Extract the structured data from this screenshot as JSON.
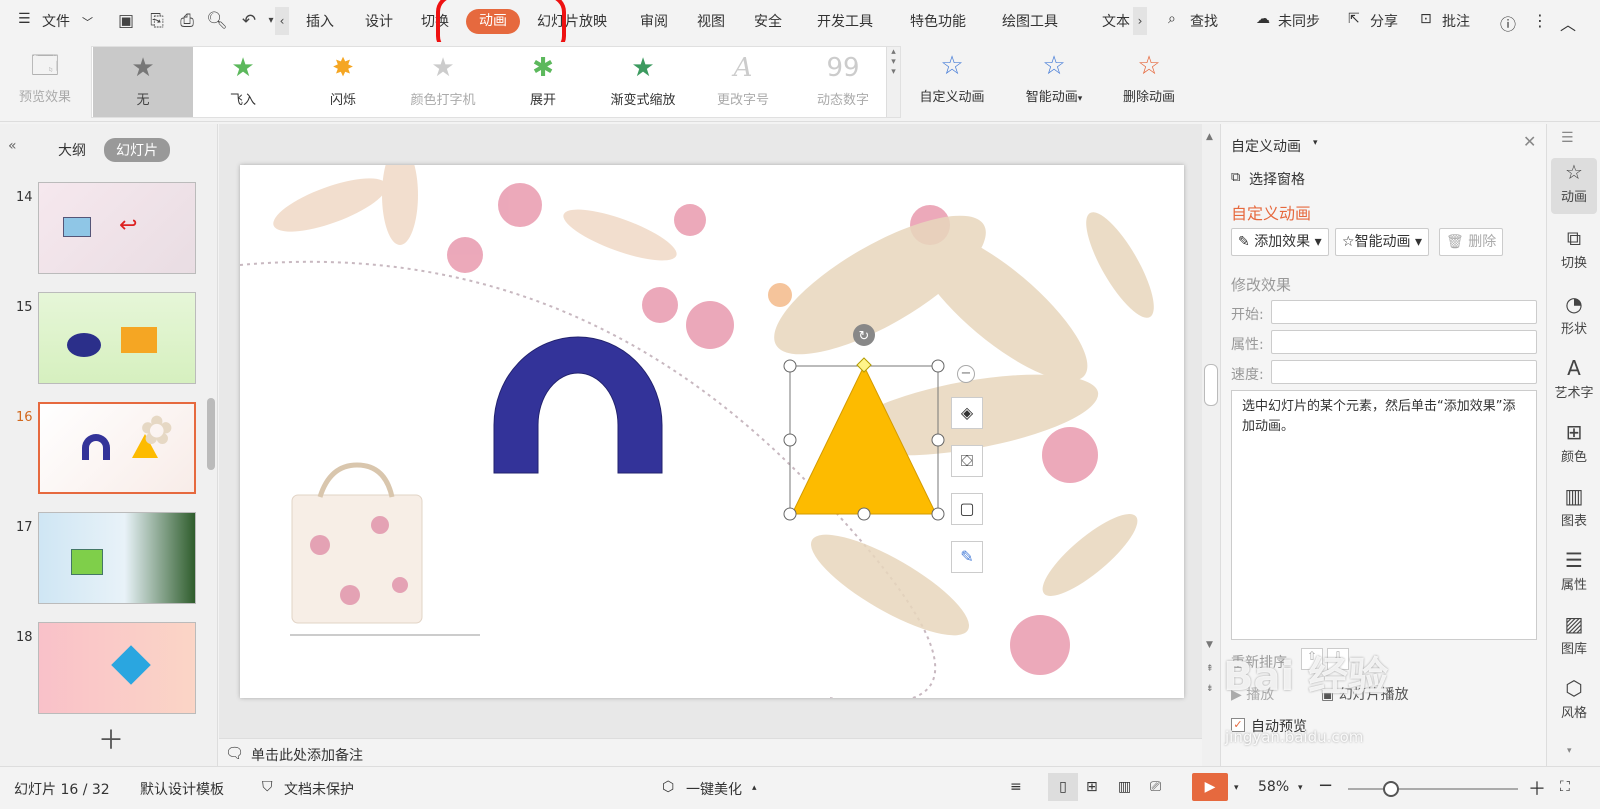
{
  "menubar": {
    "file": "文件",
    "tabs": [
      "插入",
      "设计",
      "切换",
      "动画",
      "幻灯片放映",
      "审阅",
      "视图",
      "安全",
      "开发工具",
      "特色功能",
      "绘图工具",
      "文本"
    ],
    "active_tab": "动画",
    "search": "查找",
    "sync": "未同步",
    "share": "分享",
    "review": "批注"
  },
  "ribbon": {
    "preview": "预览效果",
    "gallery": [
      "无",
      "飞入",
      "闪烁",
      "颜色打字机",
      "展开",
      "渐变式缩放",
      "更改字号",
      "动态数字"
    ],
    "custom": "自定义动画",
    "smart": "智能动画",
    "delete": "删除动画"
  },
  "leftpanel": {
    "tab_outline": "大纲",
    "tab_slides": "幻灯片",
    "slides": [
      "14",
      "15",
      "16",
      "17",
      "18"
    ],
    "active_slide": "16"
  },
  "notes": "单击此处添加备注",
  "rightpanel": {
    "title": "自定义动画",
    "select_pane": "选择窗格",
    "heading": "自定义动画",
    "add_effect": "添加效果",
    "smart_anim": "智能动画",
    "delete": "删除",
    "modify": "修改效果",
    "start": "开始:",
    "property": "属性:",
    "speed": "速度:",
    "hint": "选中幻灯片的某个元素，然后单击“添加效果”添加动画。",
    "reorder": "重新排序",
    "play": "播放",
    "slideshow": "幻灯片播放",
    "auto_preview": "自动预览"
  },
  "sidebar": [
    "动画",
    "切换",
    "形状",
    "艺术字",
    "颜色",
    "图表",
    "属性",
    "图库",
    "风格"
  ],
  "statusbar": {
    "slide_info": "幻灯片 16 / 32",
    "template": "默认设计模板",
    "protect": "文档未保护",
    "beautify": "一键美化",
    "zoom": "58%"
  },
  "watermark": {
    "text": "Bai 经验",
    "url": "jingyan.baidu.com"
  },
  "colors": {
    "accent": "#e6693e",
    "triangle": "#fdbb00",
    "arch": "#333399"
  }
}
